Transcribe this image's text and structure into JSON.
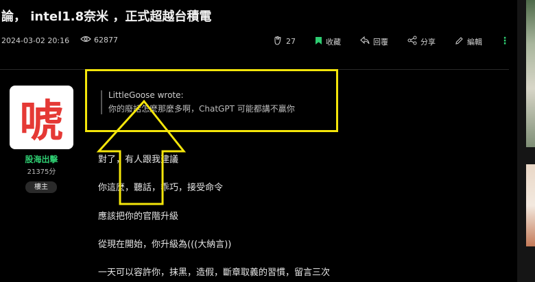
{
  "post": {
    "title": "論， intel1.8奈米 ，正式超越台積電",
    "date": "2024-03-02 20:16",
    "views": "62877"
  },
  "actions": {
    "like_count": "27",
    "bookmark_label": "收藏",
    "reply_label": "回覆",
    "share_label": "分享",
    "edit_label": "編輯",
    "more_glyph": "⋮"
  },
  "author": {
    "avatar_char": "唬",
    "name": "股海出擊",
    "points": "21375分",
    "badge": "樓主"
  },
  "quote": {
    "author_line": "LittleGoose wrote:",
    "text": "你的廢話怎麼那麼多啊，ChatGPT 可能都講不贏你"
  },
  "content_lines": [
    "對了，有人跟我建議",
    "你這麼，聽話，乖巧，接受命令",
    "應該把你的官階升級",
    "從現在開始，你升級為(((大納言))",
    "一天可以容許你，抹黑，造假，斷章取義的習慣，留言三次"
  ],
  "colors": {
    "accent_green": "#2ecc71",
    "highlight_yellow": "#f5e60a",
    "avatar_red": "#e53935"
  },
  "icons": [
    "eye-icon",
    "clap-icon",
    "bookmark-icon",
    "reply-icon",
    "share-icon",
    "pencil-icon",
    "more-icon"
  ]
}
